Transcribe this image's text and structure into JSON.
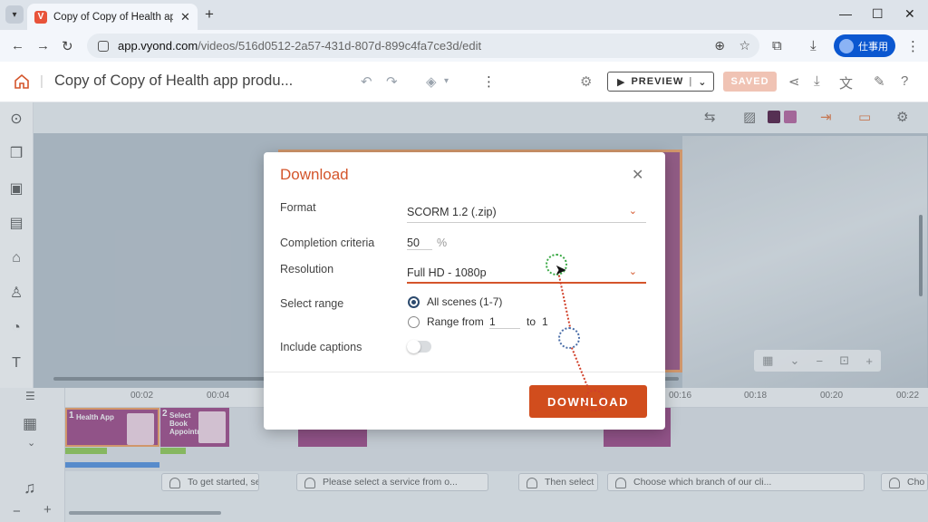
{
  "browser": {
    "tab_title": "Copy of Copy of Health app pro",
    "favicon_letter": "V",
    "url_host": "app.vyond.com",
    "url_path": "/videos/516d0512-2a57-431d-807d-899c4fa7ce3d/edit",
    "profile_label": "仕事用"
  },
  "app": {
    "title": "Copy of Copy of Health app produ...",
    "preview_label": "PREVIEW",
    "saved_label": "SAVED",
    "colors": {
      "accent": "#d14d1d",
      "swatch_dark": "#4a0f3a",
      "swatch_light": "#b45a9a"
    }
  },
  "timeline": {
    "ticks": [
      "00:02",
      "00:04",
      "00:16",
      "00:18",
      "00:20",
      "00:22"
    ],
    "clips": [
      {
        "num": "1",
        "text": "Health App"
      },
      {
        "num": "2",
        "text": "Select Book Appointment"
      }
    ],
    "captions": [
      "To get started, se",
      "Please select a service from o...",
      "Then select",
      "Choose which branch of our cli...",
      "Cho"
    ]
  },
  "dialog": {
    "title": "Download",
    "format_label": "Format",
    "format_value": "SCORM 1.2 (.zip)",
    "completion_label": "Completion criteria",
    "completion_value": "50",
    "completion_unit": "%",
    "resolution_label": "Resolution",
    "resolution_value": "Full HD - 1080p",
    "range_label": "Select range",
    "range_all": "All scenes (1-7)",
    "range_from": "Range from",
    "range_from_value": "1",
    "range_to": "to",
    "range_to_value": "1",
    "captions_label": "Include captions",
    "download_label": "DOWNLOAD"
  }
}
